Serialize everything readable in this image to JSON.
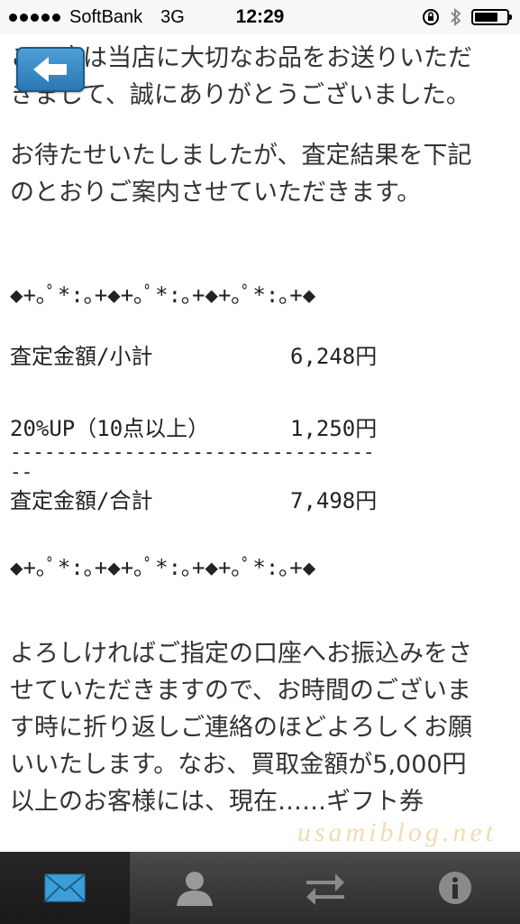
{
  "status_bar": {
    "carrier": "SoftBank",
    "network": "3G",
    "time": "12:29",
    "battery_level": 0.75
  },
  "back_button": {
    "icon": "arrow-left-icon"
  },
  "message": {
    "line1": "この度は当店に大切なお品をお送りいただ",
    "line2": "きまして、誠にありがとうございました。",
    "para2_line1": "お待たせいたしましたが、査定結果を下記",
    "para2_line2": "のとおりご案内させていただきます。",
    "divider_top": "◆+｡ﾟ*:｡+◆+｡ﾟ*:｡+◆+｡ﾟ*:｡+◆",
    "subtotal_label": "査定金額/小計",
    "subtotal_value": "6,248円",
    "bonus_label": "20%UP（10点以上）",
    "bonus_value": "1,250円",
    "dashes1": "--------------------------------",
    "dashes2": "--",
    "total_label": "査定金額/合計",
    "total_value": "7,498円",
    "divider_bottom": "◆+｡ﾟ*:｡+◆+｡ﾟ*:｡+◆+｡ﾟ*:｡+◆",
    "para3_line1": "よろしければご指定の口座へお振込みをさ",
    "para3_line2": "せていただきますので、お時間のございま",
    "para3_line3": "す時に折り返しご連絡のほどよろしくお願",
    "para3_line4": "いいたします。なお、買取金額が5,000円",
    "para3_line5": "以上のお客様には、現在……ギフト券"
  },
  "watermark": "usamiblog.net",
  "tab_bar": {
    "tabs": [
      {
        "icon": "mail-icon",
        "active": true
      },
      {
        "icon": "contact-icon",
        "active": false
      },
      {
        "icon": "transfer-icon",
        "active": false
      },
      {
        "icon": "info-icon",
        "active": false
      }
    ]
  }
}
